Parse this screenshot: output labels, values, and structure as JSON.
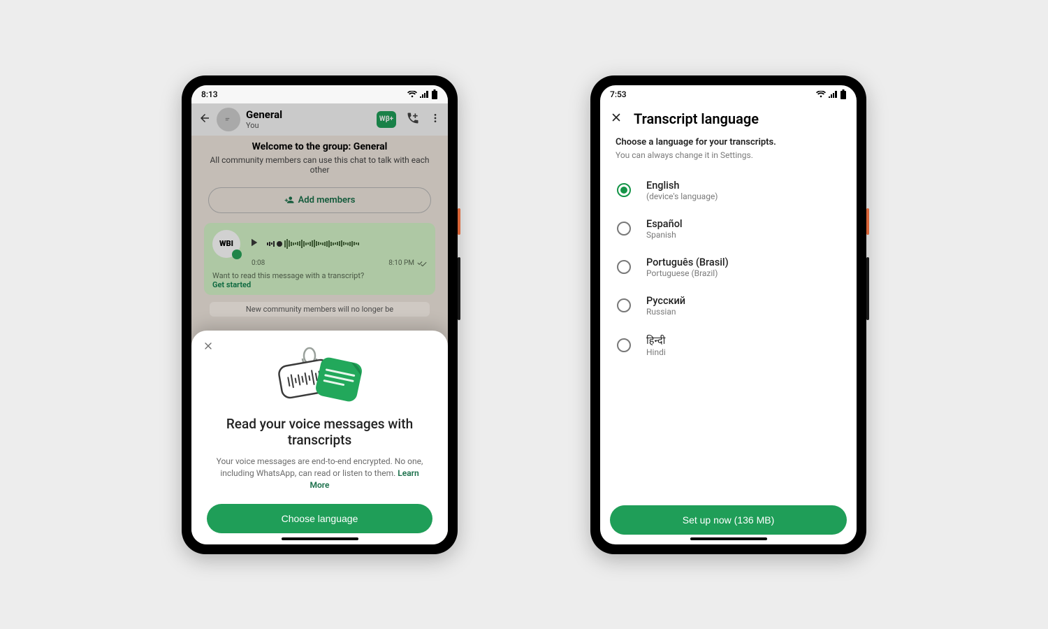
{
  "phone1": {
    "status_time": "8:13",
    "chat": {
      "title": "General",
      "subtitle": "You",
      "welcome_title": "Welcome to the group: General",
      "welcome_body": "All community members can use this chat to talk with each other",
      "add_members_label": "Add members",
      "voice": {
        "avatar_text": "WBI",
        "duration": "0:08",
        "timestamp": "8:10 PM",
        "question": "Want to read this message with a transcript?",
        "get_started": "Get started"
      },
      "system_msg": "New community members will no longer be"
    },
    "sheet": {
      "title": "Read your voice messages with transcripts",
      "body": "Your voice messages are end-to-end encrypted. No one, including WhatsApp, can read or listen to them.",
      "learn_more": "Learn More",
      "button": "Choose language"
    }
  },
  "phone2": {
    "status_time": "7:53",
    "header": "Transcript language",
    "lead": "Choose a language for your transcripts.",
    "sub": "You can always change it in Settings.",
    "languages": [
      {
        "name": "English",
        "sub": "(device's language)",
        "selected": true
      },
      {
        "name": "Español",
        "sub": "Spanish",
        "selected": false
      },
      {
        "name": "Português (Brasil)",
        "sub": "Portuguese (Brazil)",
        "selected": false
      },
      {
        "name": "Русский",
        "sub": "Russian",
        "selected": false
      },
      {
        "name": "हिन्दी",
        "sub": "Hindi",
        "selected": false
      }
    ],
    "button": "Set up now (136 MB)"
  }
}
